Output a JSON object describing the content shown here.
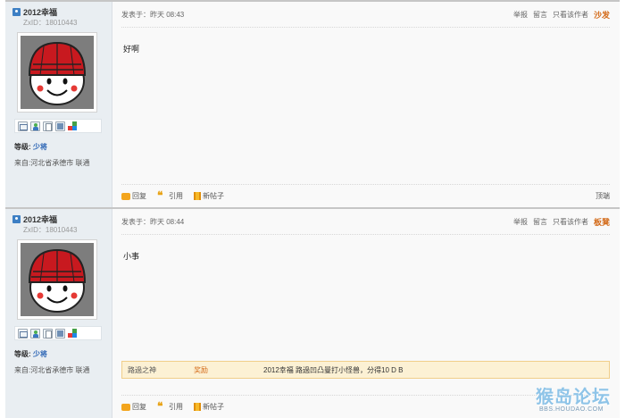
{
  "posts": [
    {
      "user": {
        "name": "2012幸福",
        "zxid": "ZxID：18010443",
        "level_label": "等级:",
        "level_value": "少将",
        "from": "来自:河北省承德市 联通"
      },
      "header": {
        "posted_at": "发表于：昨天 08:43",
        "report": "举报",
        "message": "留言",
        "only_author": "只看该作者",
        "floor": "沙发"
      },
      "content": "好啊",
      "footer": {
        "reply": "回复",
        "quote": "引用",
        "new_post": "新帖子",
        "top": "顶端"
      }
    },
    {
      "user": {
        "name": "2012幸福",
        "zxid": "ZxID：18010443",
        "level_label": "等级:",
        "level_value": "少将",
        "from": "来自:河北省承德市 联通"
      },
      "header": {
        "posted_at": "发表于：昨天 08:44",
        "report": "举报",
        "message": "留言",
        "only_author": "只看该作者",
        "floor": "板凳"
      },
      "content": "小事",
      "reward": {
        "label": "路過之神",
        "type": "奖励",
        "text": "2012幸福 路過凹凸曼打小怪兽，分得10 D B"
      },
      "footer": {
        "reply": "回复",
        "quote": "引用",
        "new_post": "新帖子"
      }
    }
  ],
  "user_icons": [
    "message-icon",
    "add-friend-icon",
    "profile-icon",
    "album-icon",
    "space-icon"
  ],
  "colors": {
    "floor_accent": "#d36a18",
    "level_accent": "#2a64b4",
    "reward_bg": "#fcf1d4",
    "sidebar_bg": "#e9eef2"
  },
  "watermark": {
    "title": "猴岛论坛",
    "url": "BBS.HOUDAO.COM"
  }
}
